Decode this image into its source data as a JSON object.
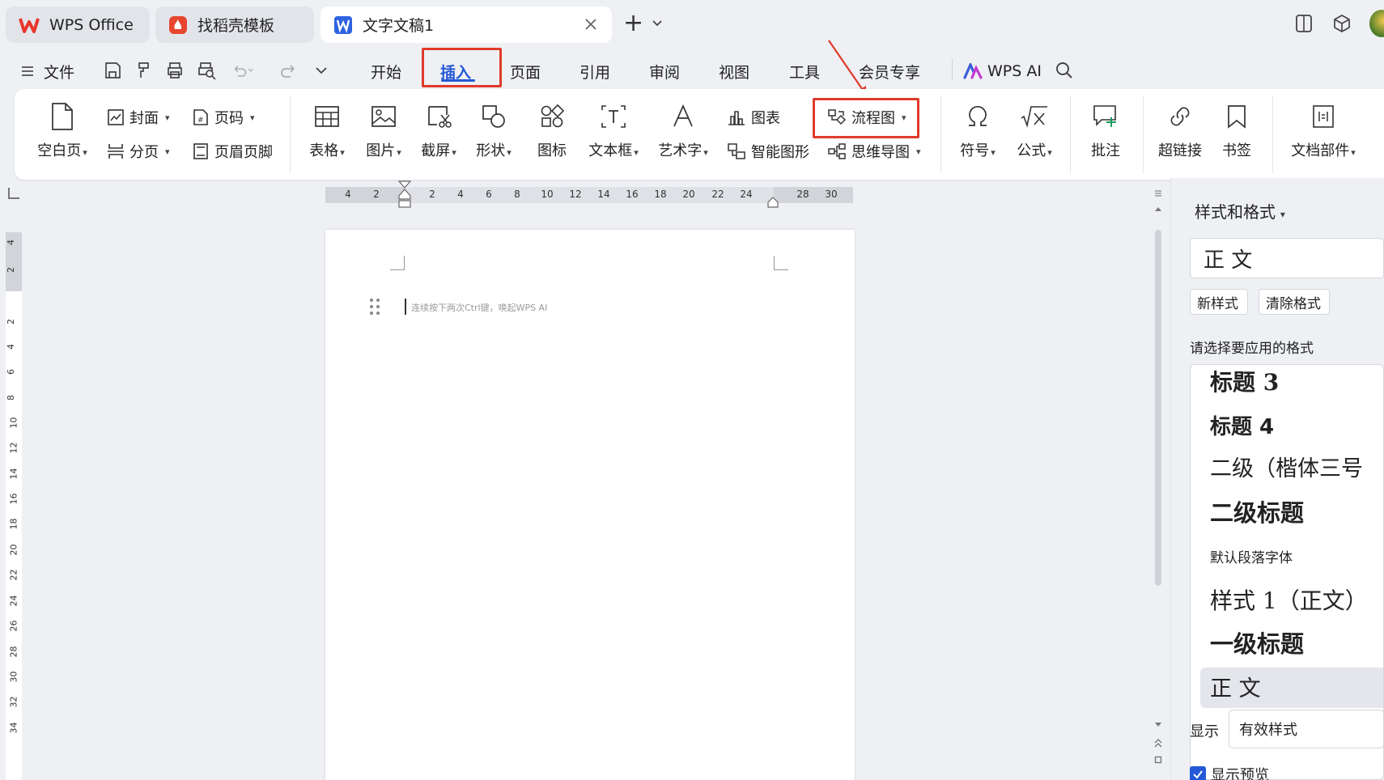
{
  "tabs": [
    {
      "label": "WPS Office"
    },
    {
      "label": "找稻壳模板"
    },
    {
      "label": "文字文稿1"
    }
  ],
  "new_tab": "+",
  "menu": {
    "file": "文件",
    "items": [
      "开始",
      "插入",
      "页面",
      "引用",
      "审阅",
      "视图",
      "工具",
      "会员专享"
    ],
    "wps_ai": "WPS AI"
  },
  "ribbon": {
    "blank_page": "空白页",
    "cover": "封面",
    "page_break": "分页",
    "page_number": "页码",
    "header_footer": "页眉页脚",
    "table": "表格",
    "picture": "图片",
    "screenshot": "截屏",
    "shape": "形状",
    "icon": "图标",
    "textbox": "文本框",
    "wordart": "艺术字",
    "chart": "图表",
    "smartart": "智能图形",
    "flowchart": "流程图",
    "mindmap": "思维导图",
    "symbol": "符号",
    "formula": "公式",
    "comment": "批注",
    "hyperlink": "超链接",
    "bookmark": "书签",
    "doc_parts": "文档部件"
  },
  "ruler": {
    "h": [
      "4",
      "2",
      "2",
      "4",
      "6",
      "8",
      "10",
      "12",
      "14",
      "16",
      "18",
      "20",
      "22",
      "24",
      "28",
      "30"
    ],
    "v": [
      "4",
      "2",
      "2",
      "4",
      "6",
      "8",
      "10",
      "12",
      "14",
      "16",
      "18",
      "20",
      "22",
      "24",
      "26",
      "28",
      "30",
      "32",
      "34"
    ]
  },
  "document": {
    "placeholder": "连续按下两次Ctrl键，唤起WPS AI"
  },
  "panel": {
    "title": "样式和格式",
    "current_style": "正 文",
    "new_style": "新样式",
    "clear_format": "清除格式",
    "choose_label": "请选择要应用的格式",
    "styles": [
      "标题 3",
      "标题 4",
      "二级（楷体三号",
      "二级标题",
      "默认段落字体",
      "样式 1（正文）",
      "一级标题",
      "正 文"
    ],
    "show_label": "显示",
    "show_value": "有效样式",
    "preview_label": "显示预览"
  },
  "colors": {
    "accent_red": "#e03a2a",
    "active_tab": "#2458d6",
    "wps_red": "#e8362c"
  }
}
